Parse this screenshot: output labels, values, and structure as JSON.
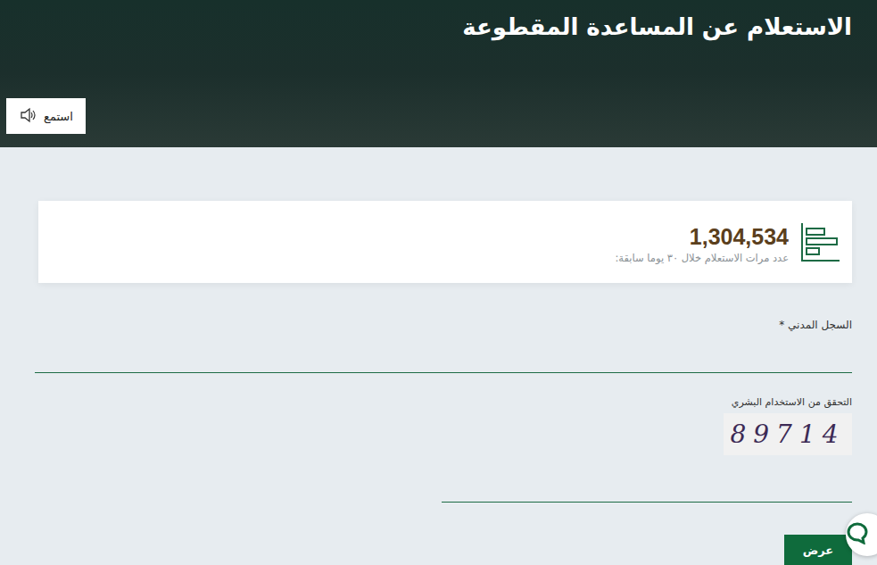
{
  "header": {
    "title": "الاستعلام عن المساعدة المقطوعة",
    "listen_button": "استمع"
  },
  "stats": {
    "count": "1,304,534",
    "caption": "عدد مرات الاستعلام خلال ٣٠ يوما سابقة:"
  },
  "form": {
    "civil_id_label": "السجل المدني *",
    "captcha_label": "التحقق من الاستخدام البشري",
    "captcha_code": "89714"
  },
  "buttons": {
    "submit": "عرض"
  }
}
